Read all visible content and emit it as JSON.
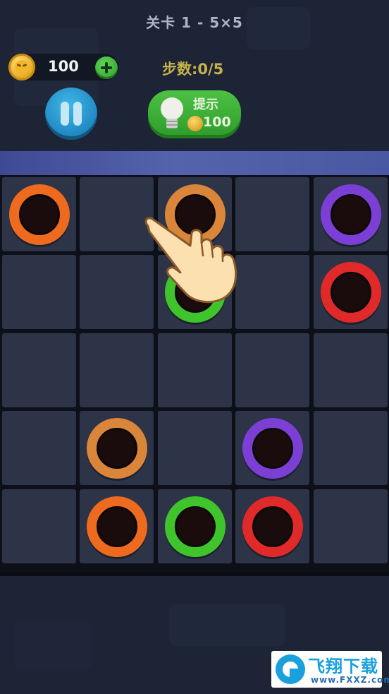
{
  "level": {
    "title": "关卡 1 - 5×5"
  },
  "coins": {
    "count": "100",
    "add_icon": "plus-icon"
  },
  "steps": {
    "text": "步数:0/5"
  },
  "pause": {
    "icon": "pause-icon"
  },
  "hint": {
    "label": "提示",
    "cost": "100",
    "icon": "lightbulb-icon"
  },
  "board": {
    "rows": 5,
    "cols": 5,
    "dots": [
      {
        "row": 0,
        "col": 0,
        "color": "orange"
      },
      {
        "row": 0,
        "col": 2,
        "color": "brown"
      },
      {
        "row": 0,
        "col": 4,
        "color": "purple"
      },
      {
        "row": 1,
        "col": 2,
        "color": "green"
      },
      {
        "row": 1,
        "col": 4,
        "color": "red"
      },
      {
        "row": 3,
        "col": 1,
        "color": "brown"
      },
      {
        "row": 3,
        "col": 3,
        "color": "purple"
      },
      {
        "row": 4,
        "col": 1,
        "color": "orange"
      },
      {
        "row": 4,
        "col": 2,
        "color": "green"
      },
      {
        "row": 4,
        "col": 3,
        "color": "red"
      }
    ],
    "colors": {
      "orange": "#ee6a1f",
      "brown": "#d9853a",
      "purple": "#7b3fd6",
      "green": "#3fc52b",
      "red": "#e02a2a"
    },
    "hand_hint": {
      "icon": "pointing-hand-icon",
      "row": 0,
      "col": 2
    }
  },
  "watermark": {
    "brand": "飞翔下载",
    "url": "www.FXXZ.com"
  }
}
